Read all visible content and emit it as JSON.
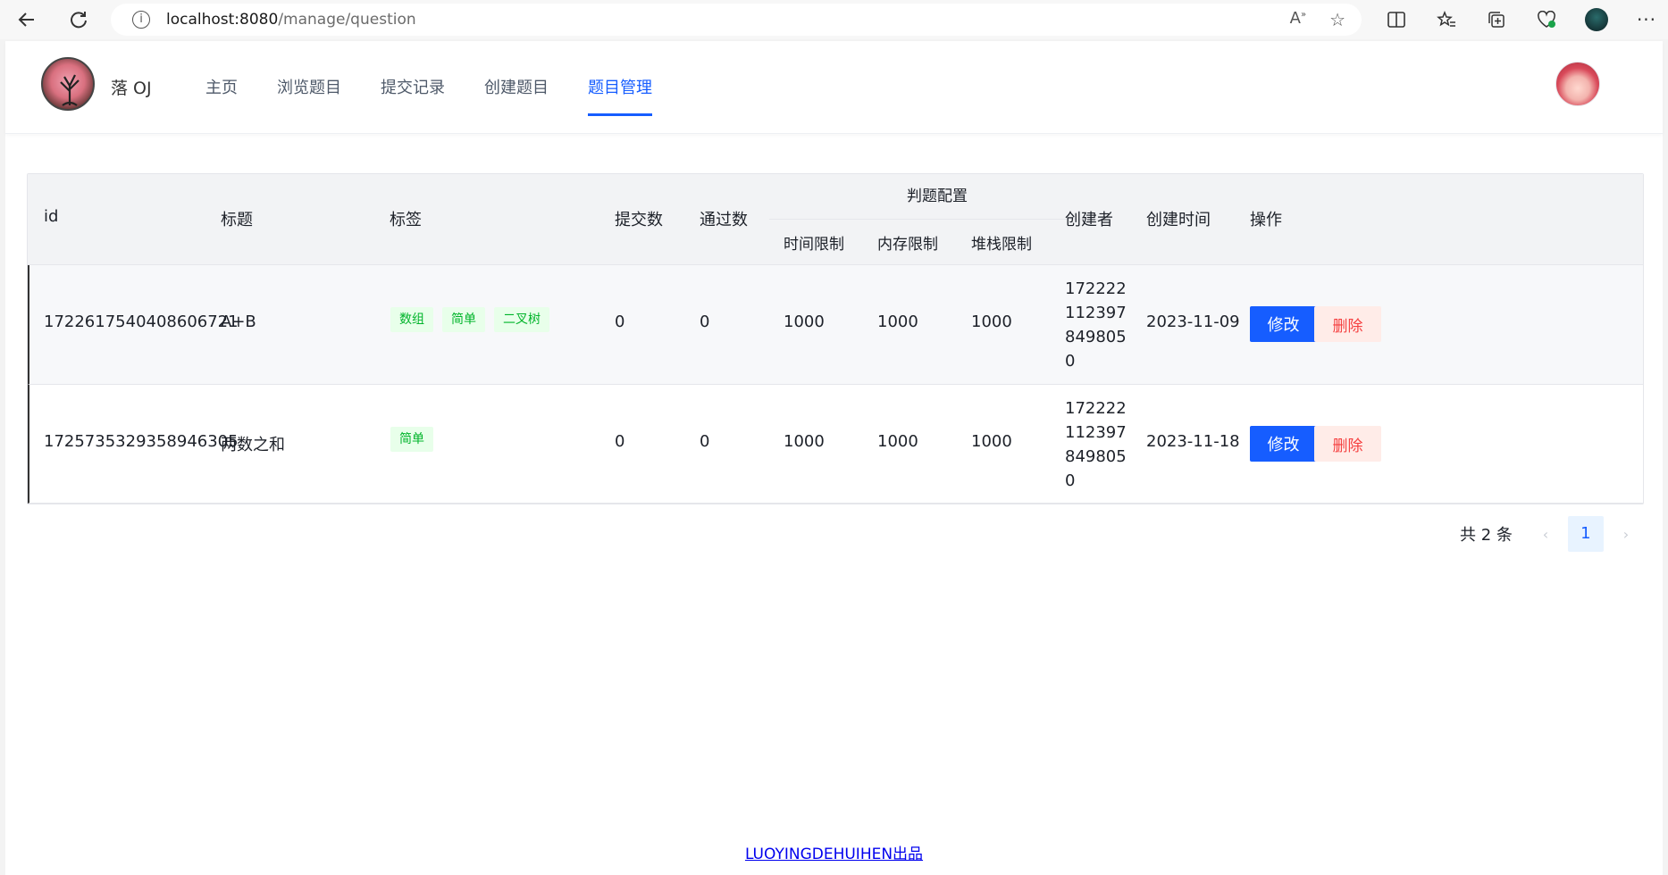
{
  "browser": {
    "url_host": "localhost:8080",
    "url_path": "/manage/question"
  },
  "header": {
    "site_title": "落 OJ",
    "menu": [
      {
        "label": "主页"
      },
      {
        "label": "浏览题目"
      },
      {
        "label": "提交记录"
      },
      {
        "label": "创建题目"
      },
      {
        "label": "题目管理",
        "active": true
      }
    ]
  },
  "table": {
    "columns": {
      "id": "id",
      "title": "标题",
      "tags": "标签",
      "submit_num": "提交数",
      "accepted_num": "通过数",
      "judge_config": "判题配置",
      "time_limit": "时间限制",
      "memory_limit": "内存限制",
      "stack_limit": "堆栈限制",
      "creator": "创建者",
      "create_time": "创建时间",
      "actions": "操作"
    },
    "rows": [
      {
        "id": "1722617540408606721",
        "title": "A+B",
        "tags": [
          "数组",
          "简单",
          "二叉树"
        ],
        "submit_num": "0",
        "accepted_num": "0",
        "time_limit": "1000",
        "memory_limit": "1000",
        "stack_limit": "1000",
        "creator": "1722221123978498050",
        "create_time": "2023-11-09",
        "edit_label": "修改",
        "delete_label": "删除"
      },
      {
        "id": "1725735329358946305",
        "title": "两数之和",
        "tags": [
          "简单"
        ],
        "submit_num": "0",
        "accepted_num": "0",
        "time_limit": "1000",
        "memory_limit": "1000",
        "stack_limit": "1000",
        "creator": "1722221123978498050",
        "create_time": "2023-11-18",
        "edit_label": "修改",
        "delete_label": "删除"
      }
    ]
  },
  "pagination": {
    "total_text": "共 2 条",
    "current_page": "1",
    "prev_icon": "‹",
    "next_icon": "›"
  },
  "footer": {
    "text": "LUOYINGDEHUIHEN出品"
  },
  "colors": {
    "primary": "#165dff",
    "tag_bg": "#e8ffea",
    "tag_text": "#00b42a",
    "danger_bg": "#ffece8",
    "danger_text": "#f53f3f"
  }
}
